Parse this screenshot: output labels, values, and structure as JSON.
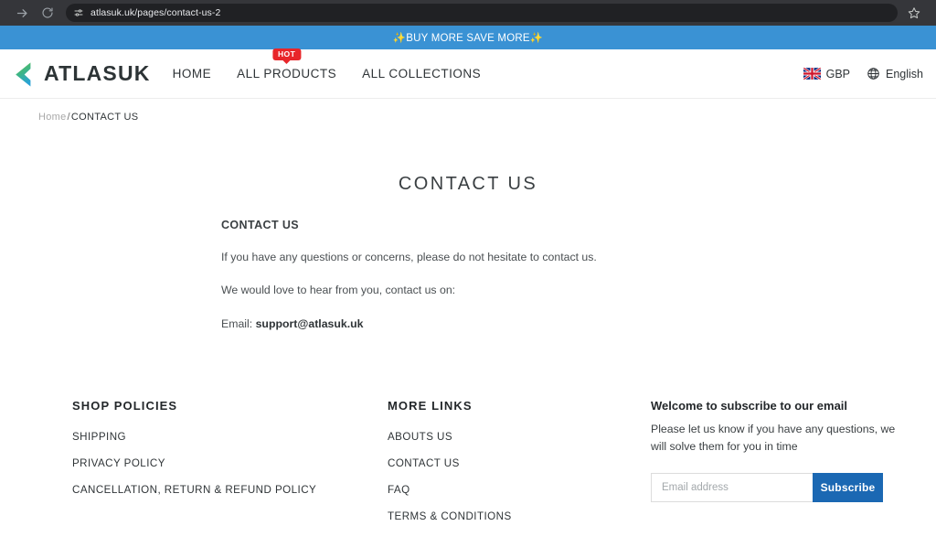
{
  "browser": {
    "forward_icon": "forward-arrow-icon",
    "reload_icon": "reload-icon",
    "site_settings_icon": "site-settings-sliders-icon",
    "url": "atlasuk.uk/pages/contact-us-2",
    "bookmark_icon": "star-icon"
  },
  "announcement": {
    "text": "✨BUY MORE SAVE MORE✨",
    "background": "#3a92d4",
    "color": "#ffffff"
  },
  "header": {
    "logo_text": "ATLASUK",
    "logo_icon": "chevron-left-logo-icon",
    "logo_gradient_from": "#62c14b",
    "logo_gradient_to": "#2aa3d4",
    "nav": [
      {
        "label": "HOME",
        "badge": null
      },
      {
        "label": "ALL PRODUCTS",
        "badge": "HOT"
      },
      {
        "label": "ALL COLLECTIONS",
        "badge": null
      }
    ],
    "badge_color": "#e8262a",
    "currency": {
      "label": "GBP",
      "icon": "uk-flag-icon"
    },
    "language": {
      "label": "English",
      "icon": "globe-icon"
    }
  },
  "breadcrumb": {
    "home": "Home",
    "separator": "/",
    "current": "CONTACT US"
  },
  "main": {
    "page_title": "CONTACT US",
    "section_heading": "CONTACT US",
    "paragraph_1": "If you have any questions or concerns, please do not hesitate to contact us.",
    "paragraph_2": "We would love to hear from you, contact us on:",
    "email_label": "Email:",
    "email_value": "support@atlasuk.uk"
  },
  "footer": {
    "shop_policies": {
      "title": "SHOP POLICIES",
      "items": [
        "SHIPPING",
        "PRIVACY POLICY",
        "CANCELLATION, RETURN & REFUND POLICY"
      ]
    },
    "more_links": {
      "title": "MORE LINKS",
      "items": [
        "ABOUTS US",
        "CONTACT US",
        "FAQ",
        "TERMS & CONDITIONS"
      ]
    },
    "newsletter": {
      "title": "Welcome to subscribe to our email",
      "description": "Please let us know if you have any questions, we will solve them for you in time",
      "input_placeholder": "Email address",
      "button_label": "Subscribe",
      "button_color": "#1b68b3"
    }
  }
}
